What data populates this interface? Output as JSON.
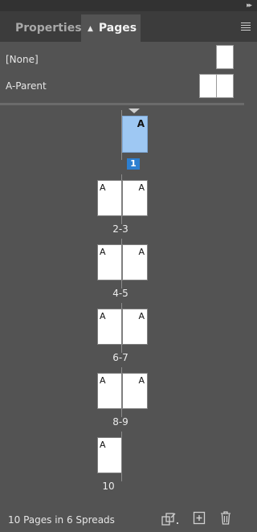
{
  "panel": {
    "tabs": [
      {
        "label": "Properties",
        "active": false
      },
      {
        "label": "Pages",
        "active": true
      }
    ]
  },
  "parents": [
    {
      "label": "[None]"
    },
    {
      "label": "A-Parent"
    }
  ],
  "spreads": [
    {
      "label": "1",
      "prefix": "A",
      "selected": true
    },
    {
      "label": "2-3",
      "prefix": "A"
    },
    {
      "label": "4-5",
      "prefix": "A"
    },
    {
      "label": "6-7",
      "prefix": "A"
    },
    {
      "label": "8-9",
      "prefix": "A"
    },
    {
      "label": "10",
      "prefix": "A"
    }
  ],
  "footer": {
    "status": "10 Pages in 6 Spreads",
    "icons": [
      "edit-page-size-icon",
      "new-page-icon",
      "delete-page-icon"
    ]
  },
  "colors": {
    "panel_bg": "#535353",
    "tab_bar_bg": "#3c3c3c",
    "selection": "#9ec8f3",
    "badge": "#2d7fd0"
  }
}
